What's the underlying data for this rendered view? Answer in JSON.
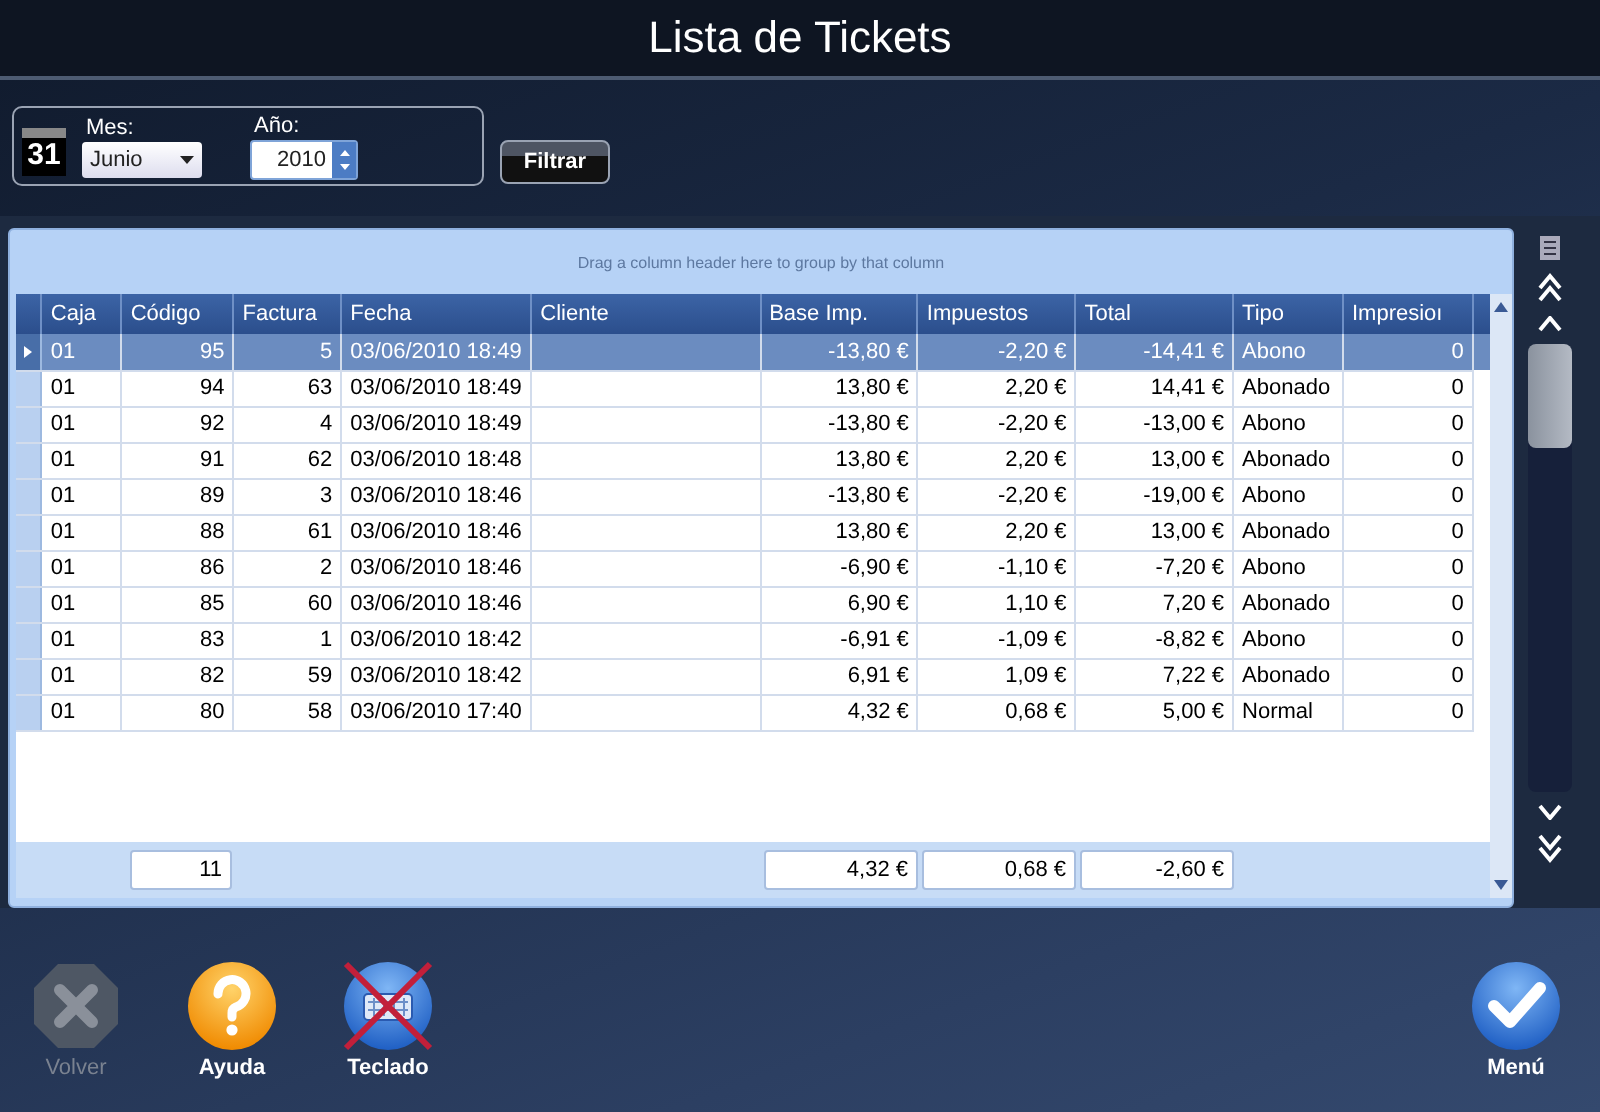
{
  "window": {
    "title": "Lista de Tickets"
  },
  "filter": {
    "month": {
      "label": "Mes:",
      "value": "Junio"
    },
    "year": {
      "label": "Año:",
      "value": "2010"
    },
    "calendar_day": "31",
    "button": "Filtrar"
  },
  "grid": {
    "group_hint": "Drag a column header here to group by that column",
    "columns": [
      {
        "label": "Caja"
      },
      {
        "label": "Código",
        "total": "11"
      },
      {
        "label": "Factura"
      },
      {
        "label": "Fecha"
      },
      {
        "label": "Cliente"
      },
      {
        "label": "Base Imp.",
        "total": "4,32 €"
      },
      {
        "label": "Impuestos",
        "total": "0,68 €"
      },
      {
        "label": "Total",
        "total": "-2,60 €"
      },
      {
        "label": "Tipo"
      },
      {
        "label": "Impresioı"
      }
    ],
    "rows": [
      {
        "selected": true,
        "cells": [
          "01",
          "95",
          "5",
          "03/06/2010 18:49",
          null,
          "-13,80 €",
          "-2,20 €",
          "-14,41 €",
          "Abono",
          "0"
        ]
      },
      {
        "selected": false,
        "cells": [
          "01",
          "94",
          "63",
          "03/06/2010 18:49",
          null,
          "13,80 €",
          "2,20 €",
          "14,41 €",
          "Abonado",
          "0"
        ]
      },
      {
        "selected": false,
        "cells": [
          "01",
          "92",
          "4",
          "03/06/2010 18:49",
          null,
          "-13,80 €",
          "-2,20 €",
          "-13,00 €",
          "Abono",
          "0"
        ]
      },
      {
        "selected": false,
        "cells": [
          "01",
          "91",
          "62",
          "03/06/2010 18:48",
          null,
          "13,80 €",
          "2,20 €",
          "13,00 €",
          "Abonado",
          "0"
        ]
      },
      {
        "selected": false,
        "cells": [
          "01",
          "89",
          "3",
          "03/06/2010 18:46",
          null,
          "-13,80 €",
          "-2,20 €",
          "-19,00 €",
          "Abono",
          "0"
        ]
      },
      {
        "selected": false,
        "cells": [
          "01",
          "88",
          "61",
          "03/06/2010 18:46",
          null,
          "13,80 €",
          "2,20 €",
          "13,00 €",
          "Abonado",
          "0"
        ]
      },
      {
        "selected": false,
        "cells": [
          "01",
          "86",
          "2",
          "03/06/2010 18:46",
          null,
          "-6,90 €",
          "-1,10 €",
          "-7,20 €",
          "Abono",
          "0"
        ]
      },
      {
        "selected": false,
        "cells": [
          "01",
          "85",
          "60",
          "03/06/2010 18:46",
          null,
          "6,90 €",
          "1,10 €",
          "7,20 €",
          "Abonado",
          "0"
        ]
      },
      {
        "selected": false,
        "cells": [
          "01",
          "83",
          "1",
          "03/06/2010 18:42",
          null,
          "-6,91 €",
          "-1,09 €",
          "-8,82 €",
          "Abono",
          "0"
        ]
      },
      {
        "selected": false,
        "cells": [
          "01",
          "82",
          "59",
          "03/06/2010 18:42",
          null,
          "6,91 €",
          "1,09 €",
          "7,22 €",
          "Abonado",
          "0"
        ]
      },
      {
        "selected": false,
        "cells": [
          "01",
          "80",
          "58",
          "03/06/2010 17:40",
          null,
          "4,32 €",
          "0,68 €",
          "5,00 €",
          "Normal",
          "0"
        ]
      }
    ]
  },
  "actions": [
    {
      "kind": "close",
      "label": "Volver",
      "disabled": true,
      "crossed": false
    },
    {
      "kind": "help",
      "label": "Ayuda",
      "disabled": false,
      "crossed": false
    },
    {
      "kind": "keyboard",
      "label": "Teclado",
      "disabled": false,
      "crossed": true
    },
    {
      "kind": "confirm",
      "label": "Menú",
      "disabled": false,
      "crossed": false
    }
  ]
}
